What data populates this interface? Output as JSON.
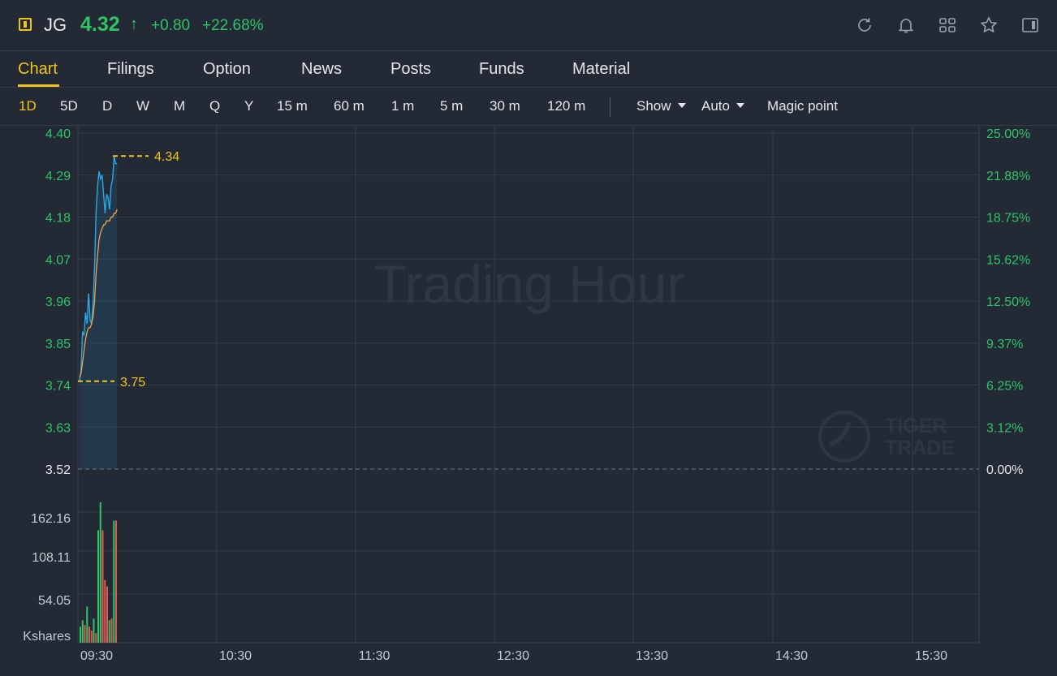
{
  "header": {
    "symbol": "JG",
    "price": "4.32",
    "price_arrow": "↑",
    "change": "+0.80",
    "change_pct": "+22.68%",
    "up_color": "#2ec466",
    "icons": [
      "refresh-icon",
      "bell-icon",
      "grid-icon",
      "star-icon",
      "panel-icon"
    ]
  },
  "tabs": [
    "Chart",
    "Filings",
    "Option",
    "News",
    "Posts",
    "Funds",
    "Material"
  ],
  "timeframes": [
    "1D",
    "5D",
    "D",
    "W",
    "M",
    "Q",
    "Y",
    "15 m",
    "60 m",
    "1 m",
    "5 m",
    "30 m",
    "120 m"
  ],
  "toolbar": {
    "show_label": "Show",
    "auto_label": "Auto",
    "magic_label": "Magic point"
  },
  "watermark": {
    "text": "Trading Hour",
    "brand_line1": "TIGER",
    "brand_line2": "TRADE"
  },
  "chart_data": {
    "type": "line",
    "price_axis": [
      "4.40",
      "4.29",
      "4.18",
      "4.07",
      "3.96",
      "3.85",
      "3.74",
      "3.63",
      "3.52"
    ],
    "pct_axis": [
      "25.00%",
      "21.88%",
      "18.75%",
      "15.62%",
      "12.50%",
      "9.37%",
      "6.25%",
      "3.12%",
      "0.00%"
    ],
    "prev_close": 3.52,
    "y_range": [
      3.52,
      4.4
    ],
    "high_label": "4.34",
    "low_label": "3.75",
    "high_value": 4.34,
    "low_value": 3.75,
    "x_labels": [
      "09:30",
      "10:30",
      "11:30",
      "12:30",
      "13:30",
      "14:30",
      "15:30"
    ],
    "price_series": [
      3.75,
      3.78,
      3.88,
      3.87,
      3.93,
      3.9,
      3.98,
      3.91,
      3.9,
      3.96,
      4.05,
      4.19,
      4.26,
      4.3,
      4.28,
      4.29,
      4.24,
      4.19,
      4.24,
      4.23,
      4.2,
      4.26,
      4.28,
      4.34,
      4.32,
      4.32
    ],
    "avg_series": [
      3.76,
      3.77,
      3.8,
      3.83,
      3.86,
      3.88,
      3.89,
      3.89,
      3.9,
      3.92,
      3.96,
      4.03,
      4.08,
      4.12,
      4.14,
      4.15,
      4.16,
      4.16,
      4.17,
      4.17,
      4.17,
      4.18,
      4.18,
      4.19,
      4.19,
      4.2
    ],
    "volume_unit": "Kshares",
    "volume_axis": [
      "162.16",
      "108.11",
      "54.05"
    ],
    "volume_max": 216.2,
    "volume_series": [
      {
        "v": 20,
        "up": true
      },
      {
        "v": 28,
        "up": true
      },
      {
        "v": 22,
        "up": false
      },
      {
        "v": 45,
        "up": true
      },
      {
        "v": 20,
        "up": false
      },
      {
        "v": 15,
        "up": false
      },
      {
        "v": 30,
        "up": true
      },
      {
        "v": 12,
        "up": false
      },
      {
        "v": 140,
        "up": true
      },
      {
        "v": 175,
        "up": true
      },
      {
        "v": 140,
        "up": false
      },
      {
        "v": 78,
        "up": false
      },
      {
        "v": 70,
        "up": false
      },
      {
        "v": 28,
        "up": true
      },
      {
        "v": 30,
        "up": false
      },
      {
        "v": 152,
        "up": true
      },
      {
        "v": 152,
        "up": false
      }
    ],
    "colors": {
      "price_line": "#2aa8e6",
      "avg_line": "#f0a24a",
      "up_bar": "#2ec466",
      "down_bar": "#e05a55",
      "axis_text": "#2ec466",
      "marker": "#f0c419"
    }
  }
}
